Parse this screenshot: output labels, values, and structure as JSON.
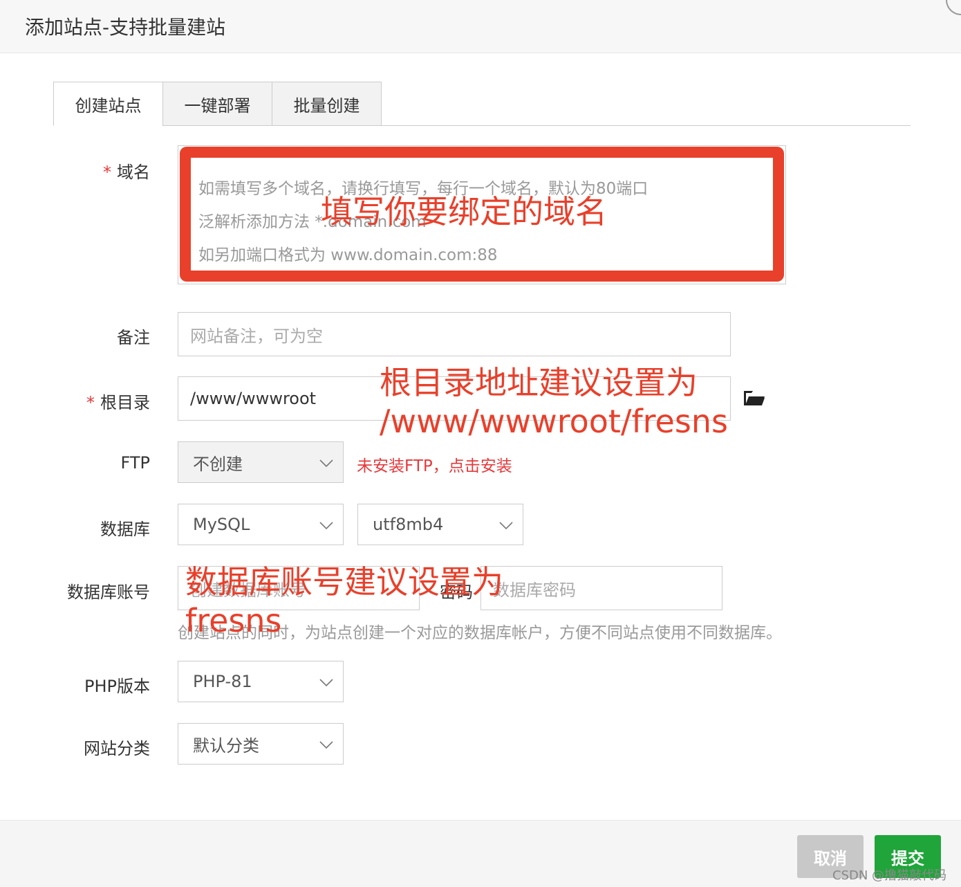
{
  "dialog": {
    "title": "添加站点-支持批量建站"
  },
  "tabs": [
    {
      "label": "创建站点"
    },
    {
      "label": "一键部署"
    },
    {
      "label": "批量创建"
    }
  ],
  "form": {
    "domain": {
      "label": "域名",
      "required_mark": "*",
      "placeholder_lines": [
        "如需填写多个域名，请换行填写，每行一个域名，默认为80端口",
        "泛解析添加方法 *.domain.com",
        "如另加端口格式为 www.domain.com:88"
      ]
    },
    "remark": {
      "label": "备注",
      "placeholder": "网站备注，可为空"
    },
    "root": {
      "label": "根目录",
      "required_mark": "*",
      "value": "/www/wwwroot",
      "folder_icon": "folder-open-icon"
    },
    "ftp": {
      "label": "FTP",
      "selected": "不创建",
      "warning": "未安装FTP，点击安装"
    },
    "database": {
      "label": "数据库",
      "type_selected": "MySQL",
      "charset_selected": "utf8mb4"
    },
    "db_account": {
      "label": "数据库账号",
      "user_placeholder": "创建数据库账号",
      "password_label": "密码",
      "password_placeholder": "数据库密码",
      "hint": "创建站点的同时，为站点创建一个对应的数据库帐户，方便不同站点使用不同数据库。"
    },
    "php": {
      "label": "PHP版本",
      "selected": "PHP-81"
    },
    "category": {
      "label": "网站分类",
      "selected": "默认分类"
    }
  },
  "footer": {
    "cancel_label": "取消",
    "submit_label": "提交",
    "watermark": "CSDN @撸猫敲代码"
  },
  "annotations": {
    "domain_note": "填写你要绑定的域名",
    "root_note_line1": "根目录地址建议设置为",
    "root_note_line2": "/www/wwwroot/fresns",
    "db_note_line1": "数据库账号建议设置为",
    "db_note_line2": "fresns",
    "highlight_color": "#e8402b"
  },
  "colors": {
    "primary_green": "#20a53a",
    "required_red": "#e4393c"
  }
}
